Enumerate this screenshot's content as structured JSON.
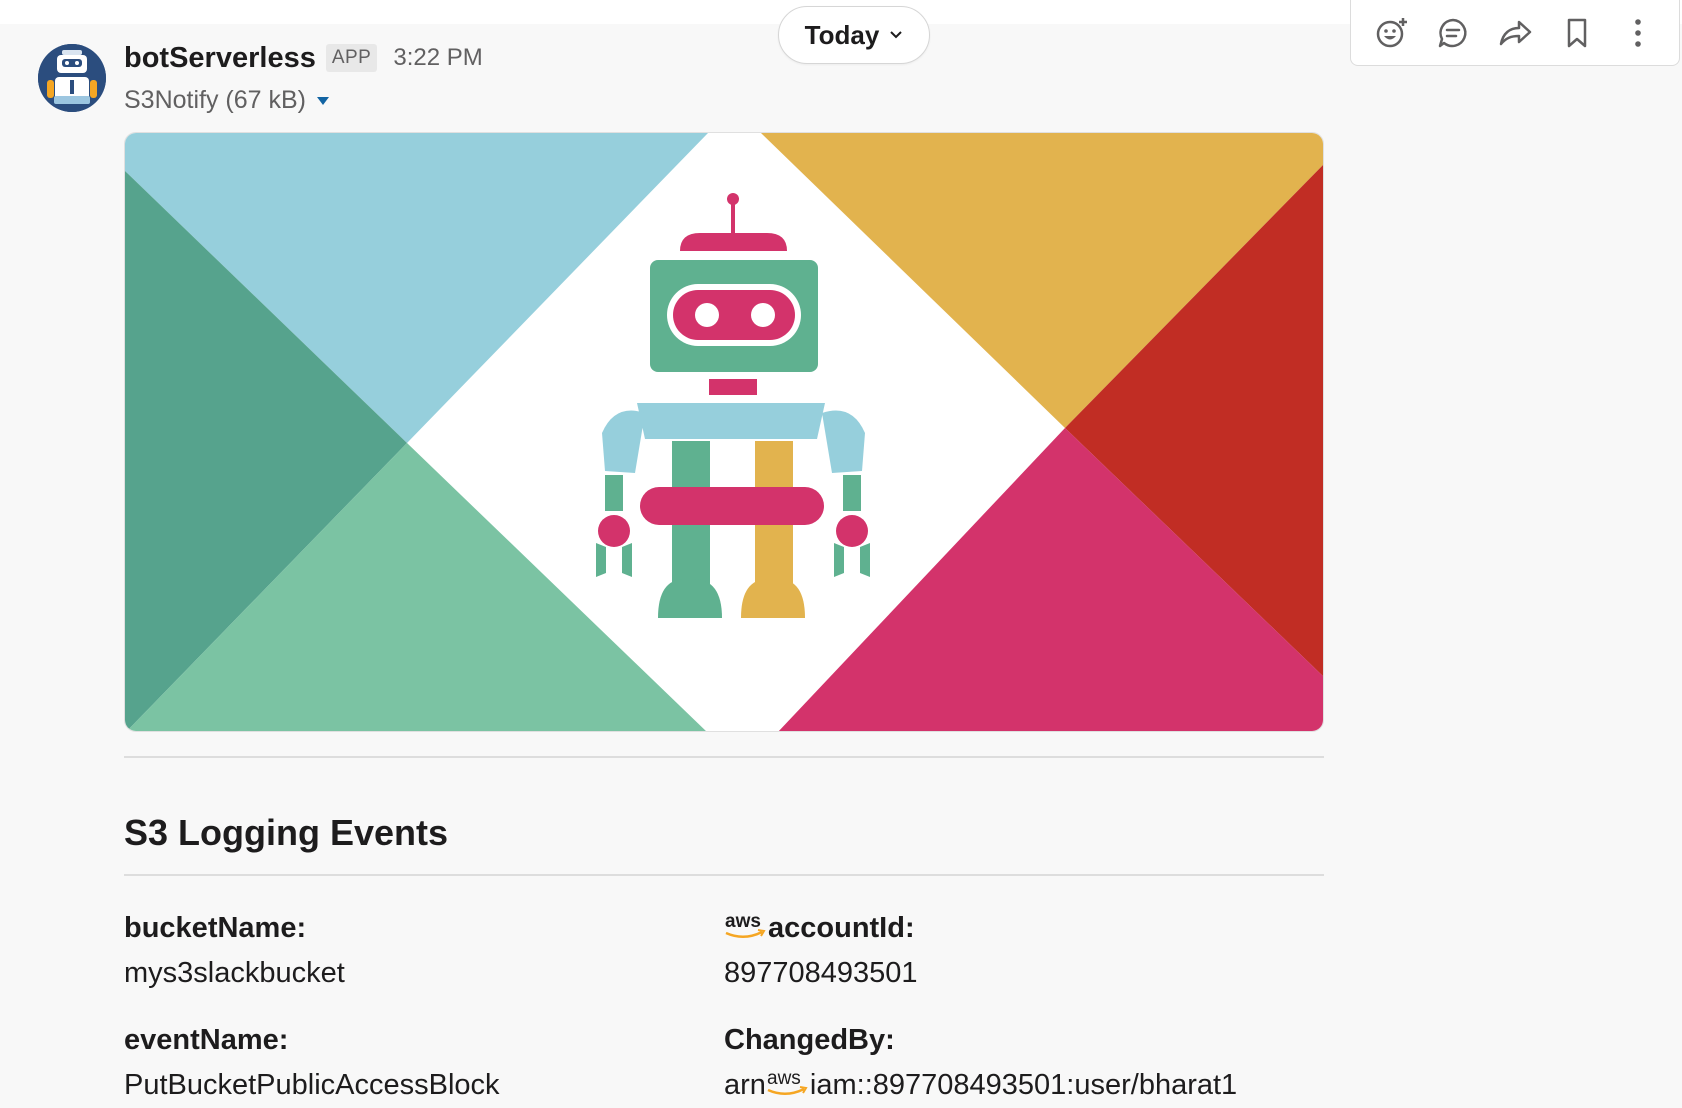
{
  "header": {
    "date_divider": "Today"
  },
  "actions": {
    "icons": [
      "add-reaction-icon",
      "reply-thread-icon",
      "share-icon",
      "bookmark-icon",
      "more-actions-icon"
    ]
  },
  "message": {
    "sender": "botServerless",
    "badge": "APP",
    "time": "3:22 PM",
    "file_label": "S3Notify (67 kB)"
  },
  "section": {
    "title": "S3 Logging Events"
  },
  "fields": {
    "bucket_label": "bucketName:",
    "bucket_value": "mys3slackbucket",
    "account_label": "accountId:",
    "account_value": "897708493501",
    "event_label": "eventName:",
    "event_value": "PutBucketPublicAccessBlock",
    "changed_label": "ChangedBy:",
    "changed_prefix": "arn",
    "changed_suffix": "iam::897708493501:user/bharat1",
    "aws_logo_text": "aws"
  },
  "colors": {
    "banner_blue": "#96cfdc",
    "banner_yellow": "#e2b34e",
    "banner_red": "#c12d24",
    "banner_pink": "#d3336b",
    "banner_green_dark": "#56a38d",
    "banner_green_light": "#7bc3a3",
    "aws_orange": "#f5a623"
  }
}
